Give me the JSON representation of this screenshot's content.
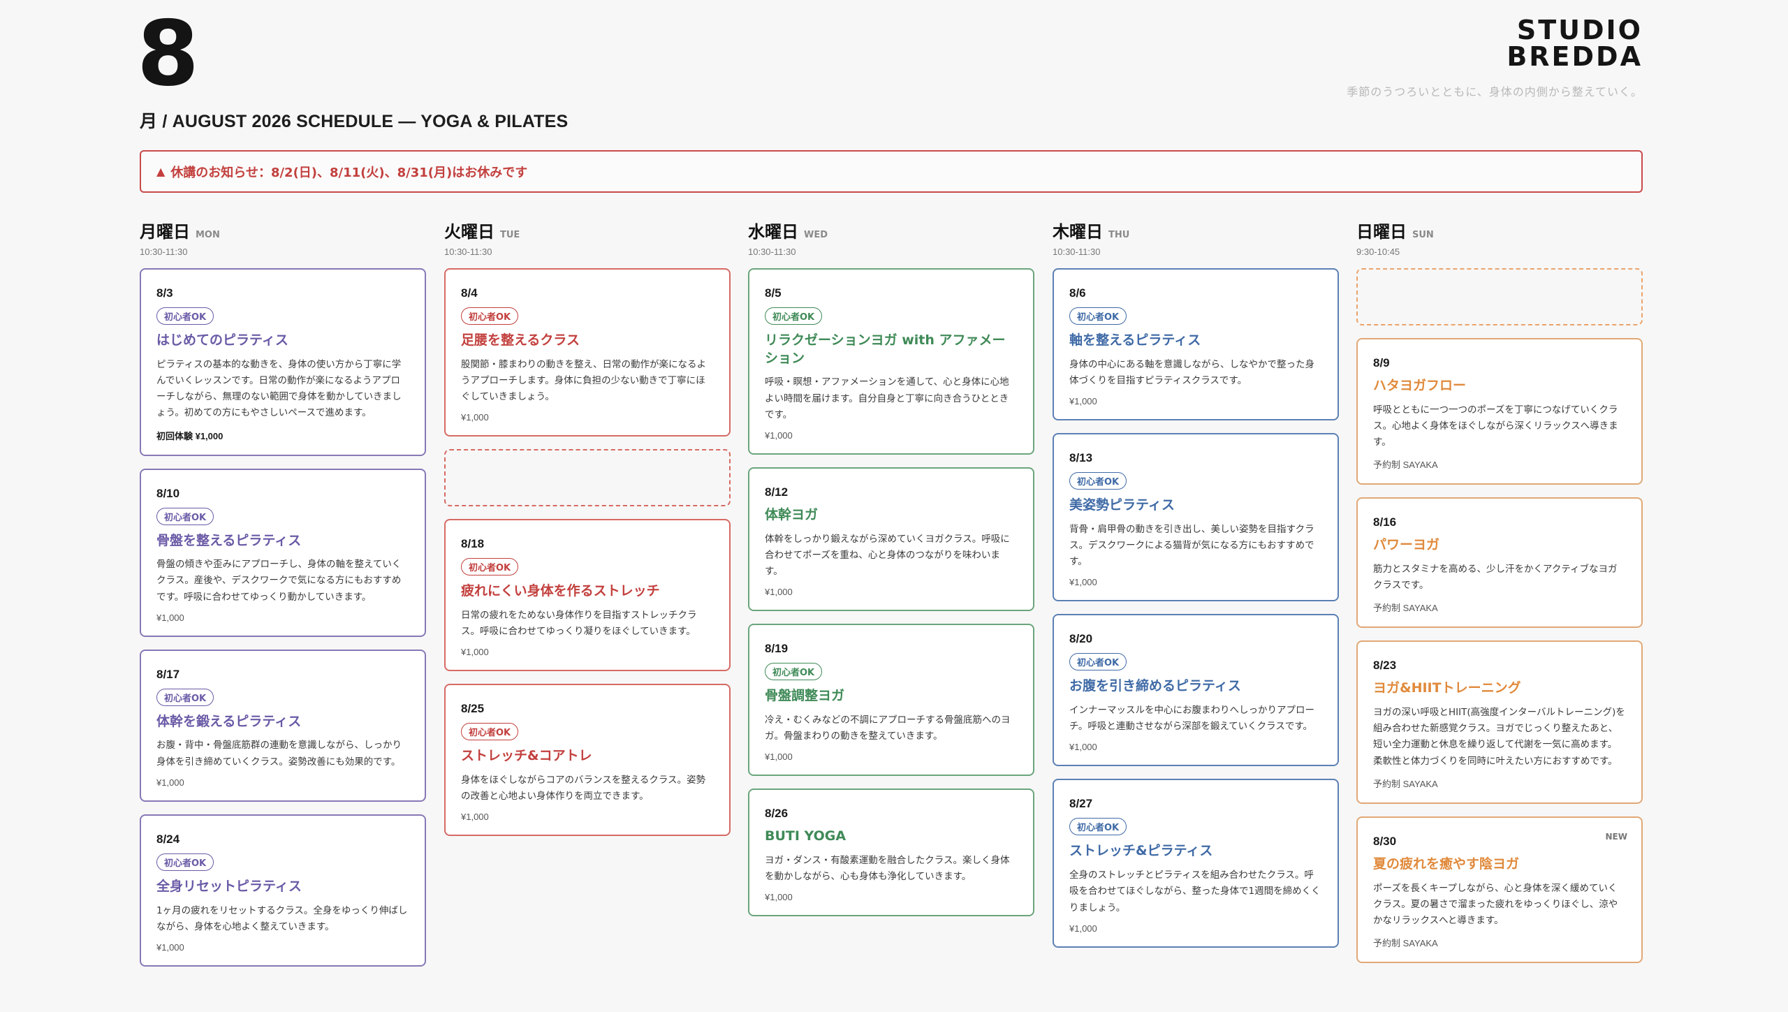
{
  "header": {
    "month": "8",
    "subtitle": "月 / AUGUST 2026 SCHEDULE — YOGA & PILATES",
    "brand_line1": "STUDIO",
    "brand_line2": "BREDDA",
    "tagline": "季節のうつろいとともに、身体の内側から整えていく。"
  },
  "notice": {
    "icon": "warning-triangle-icon",
    "text": "休講のお知らせ：8/2(日)、8/11(火)、8/31(月)はお休みです"
  },
  "colors": {
    "purple": "#6a5aa6",
    "red": "#c2403e",
    "green": "#3f8a57",
    "blue": "#3f6aa6",
    "orange": "#e08a3c"
  },
  "columns": [
    {
      "day": "月曜日",
      "en": "MON",
      "time": "10:30-11:30",
      "theme": "purple",
      "cards": [
        {
          "date": "8/3",
          "badge": "初心者OK",
          "title": "はじめてのピラティス",
          "desc": "ピラティスの基本的な動きを、身体の使い方から丁寧に学んでいくレッスンです。日常の動作が楽になるようアプローチしながら、無理のない範囲で身体を動かしていきましょう。初めての方にもやさしいペースで進めます。",
          "price": "初回体験 ¥1,000",
          "price_bold": true
        },
        {
          "date": "8/10",
          "badge": "初心者OK",
          "title": "骨盤を整えるピラティス",
          "desc": "骨盤の傾きや歪みにアプローチし、身体の軸を整えていくクラス。産後や、デスクワークで気になる方にもおすすめです。呼吸に合わせてゆっくり動かしていきます。",
          "price": "¥1,000"
        },
        {
          "date": "8/17",
          "badge": "初心者OK",
          "title": "体幹を鍛えるピラティス",
          "desc": "お腹・背中・骨盤底筋群の連動を意識しながら、しっかり身体を引き締めていくクラス。姿勢改善にも効果的です。",
          "price": "¥1,000"
        },
        {
          "date": "8/24",
          "badge": "初心者OK",
          "title": "全身リセットピラティス",
          "desc": "1ヶ月の疲れをリセットするクラス。全身をゆっくり伸ばしながら、身体を心地よく整えていきます。",
          "price": "¥1,000"
        }
      ]
    },
    {
      "day": "火曜日",
      "en": "TUE",
      "time": "10:30-11:30",
      "theme": "red",
      "cards": [
        {
          "date": "8/4",
          "badge": "初心者OK",
          "title": "足腰を整えるクラス",
          "desc": "股関節・膝まわりの動きを整え、日常の動作が楽になるようアプローチします。身体に負担の少ない動きで丁寧にほぐしていきましょう。",
          "price": "¥1,000"
        },
        {
          "empty": true
        },
        {
          "date": "8/18",
          "badge": "初心者OK",
          "title": "疲れにくい身体を作るストレッチ",
          "desc": "日常の疲れをためない身体作りを目指すストレッチクラス。呼吸に合わせてゆっくり凝りをほぐしていきます。",
          "price": "¥1,000"
        },
        {
          "date": "8/25",
          "badge": "初心者OK",
          "title": "ストレッチ&コアトレ",
          "desc": "身体をほぐしながらコアのバランスを整えるクラス。姿勢の改善と心地よい身体作りを両立できます。",
          "price": "¥1,000"
        }
      ]
    },
    {
      "day": "水曜日",
      "en": "WED",
      "time": "10:30-11:30",
      "theme": "green",
      "cards": [
        {
          "date": "8/5",
          "badge": "初心者OK",
          "title": "リラクゼーションヨガ with アファメーション",
          "desc": "呼吸・瞑想・アファメーションを通して、心と身体に心地よい時間を届けます。自分自身と丁寧に向き合うひとときです。",
          "price": "¥1,000"
        },
        {
          "date": "8/12",
          "title": "体幹ヨガ",
          "desc": "体幹をしっかり鍛えながら深めていくヨガクラス。呼吸に合わせてポーズを重ね、心と身体のつながりを味わいます。",
          "price": "¥1,000"
        },
        {
          "date": "8/19",
          "badge": "初心者OK",
          "title": "骨盤調整ヨガ",
          "desc": "冷え・むくみなどの不調にアプローチする骨盤底筋へのヨガ。骨盤まわりの動きを整えていきます。",
          "price": "¥1,000"
        },
        {
          "date": "8/26",
          "title": "BUTI YOGA",
          "desc": "ヨガ・ダンス・有酸素運動を融合したクラス。楽しく身体を動かしながら、心も身体も浄化していきます。",
          "price": "¥1,000"
        }
      ]
    },
    {
      "day": "木曜日",
      "en": "THU",
      "time": "10:30-11:30",
      "theme": "blue",
      "cards": [
        {
          "date": "8/6",
          "badge": "初心者OK",
          "title": "軸を整えるピラティス",
          "desc": "身体の中心にある軸を意識しながら、しなやかで整った身体づくりを目指すピラティスクラスです。",
          "price": "¥1,000"
        },
        {
          "date": "8/13",
          "badge": "初心者OK",
          "title": "美姿勢ピラティス",
          "desc": "背骨・肩甲骨の動きを引き出し、美しい姿勢を目指すクラス。デスクワークによる猫背が気になる方にもおすすめです。",
          "price": "¥1,000"
        },
        {
          "date": "8/20",
          "badge": "初心者OK",
          "title": "お腹を引き締めるピラティス",
          "desc": "インナーマッスルを中心にお腹まわりへしっかりアプローチ。呼吸と連動させながら深部を鍛えていくクラスです。",
          "price": "¥1,000"
        },
        {
          "date": "8/27",
          "badge": "初心者OK",
          "title": "ストレッチ&ピラティス",
          "desc": "全身のストレッチとピラティスを組み合わせたクラス。呼吸を合わせてほぐしながら、整った身体で1週間を締めくくりましょう。",
          "price": "¥1,000"
        }
      ]
    },
    {
      "day": "日曜日",
      "en": "SUN",
      "time": "9:30-10:45",
      "theme": "orange",
      "cards": [
        {
          "empty": true
        },
        {
          "date": "8/9",
          "title": "ハタヨガフロー",
          "desc": "呼吸とともに一つ一つのポーズを丁寧につなげていくクラス。心地よく身体をほぐしながら深くリラックスへ導きます。",
          "price": "予約制 SAYAKA"
        },
        {
          "date": "8/16",
          "title": "パワーヨガ",
          "desc": "筋力とスタミナを高める、少し汗をかくアクティブなヨガクラスです。",
          "price": "予約制 SAYAKA"
        },
        {
          "date": "8/23",
          "title": "ヨガ&HIITトレーニング",
          "desc": "ヨガの深い呼吸とHIIT(高強度インターバルトレーニング)を組み合わせた新感覚クラス。ヨガでじっくり整えたあと、短い全力運動と休息を繰り返して代謝を一気に高めます。柔軟性と体力づくりを同時に叶えたい方におすすめです。",
          "price": "予約制 SAYAKA"
        },
        {
          "date": "8/30",
          "new": "NEW",
          "title": "夏の疲れを癒やす陰ヨガ",
          "desc": "ポーズを長くキープしながら、心と身体を深く緩めていくクラス。夏の暑さで溜まった疲れをゆっくりほぐし、涼やかなリラックスへと導きます。",
          "price": "予約制 SAYAKA"
        }
      ]
    }
  ]
}
